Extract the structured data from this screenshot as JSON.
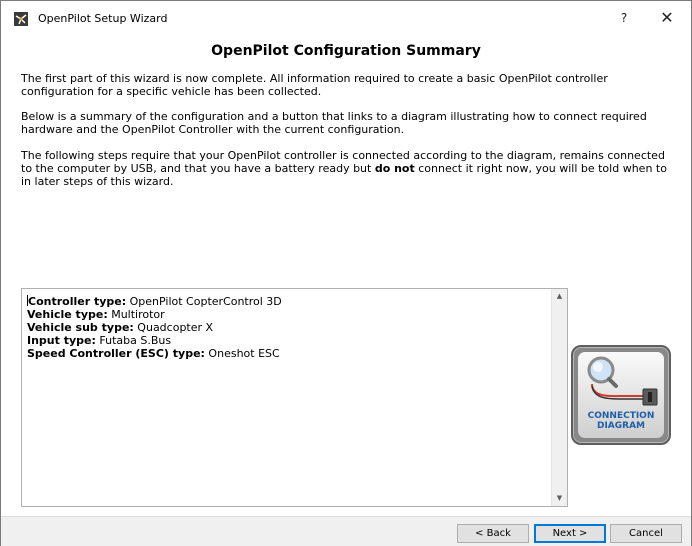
{
  "window": {
    "title": "OpenPilot Setup Wizard",
    "help_glyph": "?",
    "close_glyph": "✕"
  },
  "page": {
    "title": "OpenPilot Configuration Summary",
    "paragraph1": "The first part of this wizard is now complete. All information required to create a basic OpenPilot controller configuration for a specific vehicle has been collected.",
    "paragraph2": "Below is a summary of the configuration and a button that links to a diagram illustrating how to connect required hardware and the OpenPilot Controller with the current configuration.",
    "paragraph3_before": "The following steps require that your OpenPilot controller is connected according to the diagram, remains connected to the computer by USB, and that you have a battery ready but ",
    "paragraph3_bold": "do not",
    "paragraph3_after": " connect it right now, you will be told when to in later steps of this wizard."
  },
  "summary": {
    "lines": [
      {
        "label": "Controller type:",
        "value": " OpenPilot CopterControl 3D"
      },
      {
        "label": "Vehicle type:",
        "value": " Multirotor"
      },
      {
        "label": "Vehicle sub type:",
        "value": " Quadcopter X"
      },
      {
        "label": "Input type:",
        "value": " Futaba S.Bus"
      },
      {
        "label": "Speed Controller (ESC) type:",
        "value": " Oneshot ESC"
      }
    ]
  },
  "diagram_button": {
    "line1": "CONNECTION",
    "line2": "DIAGRAM"
  },
  "footer": {
    "back_label": "< Back",
    "next_label": "Next >",
    "cancel_label": "Cancel"
  },
  "colors": {
    "accent": "#0078d7",
    "diagram_label": "#1d5fa8"
  }
}
